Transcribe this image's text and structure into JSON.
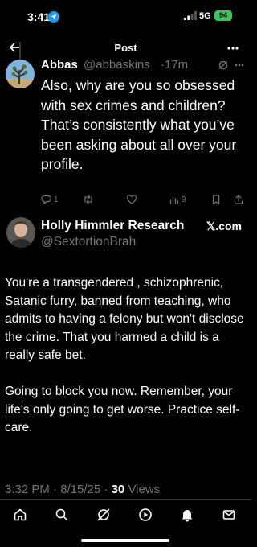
{
  "status_bar": {
    "time": "3:41",
    "network": "5G",
    "battery": "94"
  },
  "header": {
    "title": "Post"
  },
  "reply": {
    "name": "Abbas",
    "handle": "@abbaskins",
    "time": "·17m",
    "text": "Also, why are you so obsessed with sex crimes and children? That’s consistently what you’ve been asking about all over your profile.",
    "actions": {
      "replies": "1",
      "retweets": "",
      "likes": "",
      "views": "9"
    }
  },
  "main_post": {
    "name": "Holly Himmler Research",
    "badge": "𝕏.com",
    "handle": "@SextortionBrah",
    "paragraphs": [
      "You're a transgendered , schizophrenic, Satanic furry, banned from teaching, who admits to having a felony but won't disclose the crime. That you harmed a child is a really safe bet.",
      "Going to block you now. Remember, your life's only going to get worse. Practice self-care."
    ],
    "timestamp": "3:32 PM · 8/15/25 ·",
    "views_count": "30",
    "views_label": "Views"
  },
  "colors": {
    "accent": "#1d9bf0",
    "muted": "#71767b",
    "battery": "#34c759"
  },
  "icons": [
    "location-arrow-icon",
    "signal-icon",
    "back-arrow-icon",
    "more-icon",
    "grok-icon",
    "reply-icon",
    "retweet-icon",
    "like-icon",
    "views-icon",
    "bookmark-icon",
    "share-icon",
    "home-icon",
    "search-icon",
    "grok-nav-icon",
    "video-icon",
    "notifications-icon",
    "messages-icon"
  ]
}
